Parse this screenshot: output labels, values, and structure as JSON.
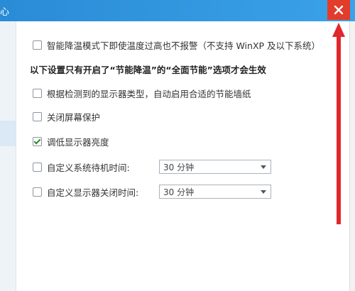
{
  "window": {
    "title_fragment": "心",
    "close_glyph": "✕"
  },
  "options": {
    "no_alarm": {
      "label": "智能降温模式下即使温度过高也不报警（不支持 WinXP 及以下系统）",
      "checked": false
    },
    "section_heading": "以下设置只有开启了“节能降温”的“全面节能”选项才会生效",
    "wallpaper": {
      "label": "根据检测到的显示器类型，自动启用合适的节能墙纸",
      "checked": false
    },
    "screensaver": {
      "label": "关闭屏幕保护",
      "checked": false
    },
    "brightness": {
      "label": "调低显示器亮度",
      "checked": true
    },
    "standby": {
      "label": "自定义系统待机时间:",
      "checked": false,
      "value": "30 分钟"
    },
    "monitor_off": {
      "label": "自定义显示器关闭时间:",
      "checked": false,
      "value": "30 分钟"
    }
  },
  "colors": {
    "titlebar": "#2a8bd6",
    "close_button": "#e23c2b",
    "annotation_arrow": "#e0282d"
  }
}
